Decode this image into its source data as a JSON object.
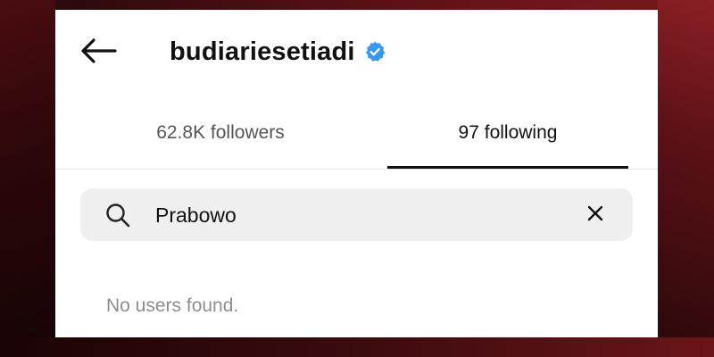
{
  "header": {
    "back_icon": "arrow-left-icon",
    "username": "budiariesetiadi",
    "verified_icon": "verified-badge-icon",
    "verified_color": "#3897f0"
  },
  "tabs": [
    {
      "label": "62.8K followers",
      "active": false
    },
    {
      "label": "97 following",
      "active": true
    }
  ],
  "search": {
    "icon": "search-icon",
    "value": "Prabowo",
    "clear_icon": "close-icon"
  },
  "results": {
    "empty_message": "No users found."
  },
  "colors": {
    "text_primary": "#111111",
    "text_secondary": "#555555",
    "text_muted": "#8e8e8e",
    "search_bg": "#efefef",
    "backdrop": "#5a1015"
  }
}
